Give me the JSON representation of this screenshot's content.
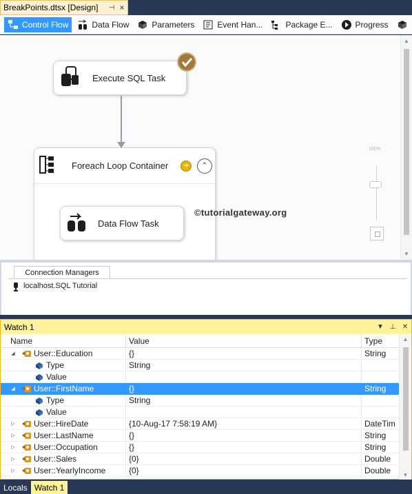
{
  "document_tab": {
    "title": "BreakPoints.dtsx [Design]",
    "pin_glyph": "⊣",
    "close_glyph": "×"
  },
  "designer_tabs": [
    {
      "label": "Control Flow",
      "icon": "control-flow-icon",
      "active": true
    },
    {
      "label": "Data Flow",
      "icon": "data-flow-icon",
      "active": false
    },
    {
      "label": "Parameters",
      "icon": "parameters-icon",
      "active": false
    },
    {
      "label": "Event Han...",
      "icon": "event-handlers-icon",
      "active": false
    },
    {
      "label": "Package E...",
      "icon": "package-explorer-icon",
      "active": false
    },
    {
      "label": "Progress",
      "icon": "progress-icon",
      "active": false
    }
  ],
  "canvas": {
    "execute_sql_task": {
      "label": "Execute SQL Task",
      "status": "success"
    },
    "foreach_container": {
      "label": "Foreach Loop Container",
      "breakpoint": true
    },
    "data_flow_task": {
      "label": "Data Flow Task"
    },
    "watermark": "©tutorialgateway.org",
    "zoom_label": "100%"
  },
  "connection_managers": {
    "tab_label": "Connection Managers",
    "items": [
      {
        "label": "localhost.SQL Tutorial",
        "icon": "connection-icon"
      }
    ]
  },
  "watch": {
    "title": "Watch 1",
    "columns": {
      "name": "Name",
      "value": "Value",
      "type": "Type"
    },
    "rows": [
      {
        "name": "User::Education",
        "value": "{}",
        "type": "String",
        "level": 0,
        "expander": "expanded",
        "icon": "variable-icon",
        "selected": false
      },
      {
        "name": "Type",
        "value": "String",
        "type": "",
        "level": 1,
        "expander": "none",
        "icon": "property-icon",
        "selected": false
      },
      {
        "name": "Value",
        "value": "",
        "type": "",
        "level": 1,
        "expander": "none",
        "icon": "property-icon",
        "selected": false
      },
      {
        "name": "User::FirstName",
        "value": "{}",
        "type": "String",
        "level": 0,
        "expander": "expanded",
        "icon": "variable-icon",
        "selected": true
      },
      {
        "name": "Type",
        "value": "String",
        "type": "",
        "level": 1,
        "expander": "none",
        "icon": "property-icon",
        "selected": false
      },
      {
        "name": "Value",
        "value": "",
        "type": "",
        "level": 1,
        "expander": "none",
        "icon": "property-icon",
        "selected": false
      },
      {
        "name": "User::HireDate",
        "value": "{10-Aug-17 7:58:19 AM}",
        "type": "DateTim",
        "level": 0,
        "expander": "collapsed",
        "icon": "variable-icon",
        "selected": false
      },
      {
        "name": "User::LastName",
        "value": "{}",
        "type": "String",
        "level": 0,
        "expander": "collapsed",
        "icon": "variable-icon",
        "selected": false
      },
      {
        "name": "User::Occupation",
        "value": "{}",
        "type": "String",
        "level": 0,
        "expander": "collapsed",
        "icon": "variable-icon",
        "selected": false
      },
      {
        "name": "User::Sales",
        "value": "{0}",
        "type": "Double",
        "level": 0,
        "expander": "collapsed",
        "icon": "variable-icon",
        "selected": false
      },
      {
        "name": "User::YearlyIncome",
        "value": "{0}",
        "type": "Double",
        "level": 0,
        "expander": "collapsed",
        "icon": "variable-icon",
        "selected": false
      }
    ]
  },
  "bottom_tabs": [
    {
      "label": "Locals",
      "active": false
    },
    {
      "label": "Watch 1",
      "active": true
    }
  ],
  "colors": {
    "selection": "#3399ff",
    "chrome": "#293955",
    "tool_window_title": "#fff29d"
  }
}
